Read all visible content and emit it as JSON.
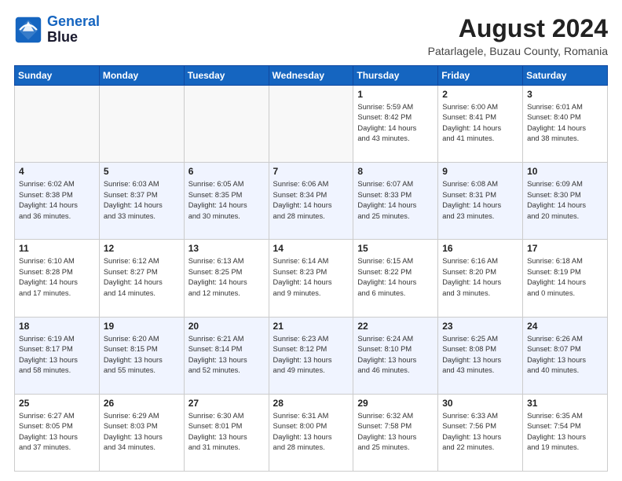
{
  "header": {
    "logo_line1": "General",
    "logo_line2": "Blue",
    "month_title": "August 2024",
    "location": "Patarlagele, Buzau County, Romania"
  },
  "days_of_week": [
    "Sunday",
    "Monday",
    "Tuesday",
    "Wednesday",
    "Thursday",
    "Friday",
    "Saturday"
  ],
  "weeks": [
    [
      {
        "day": "",
        "info": ""
      },
      {
        "day": "",
        "info": ""
      },
      {
        "day": "",
        "info": ""
      },
      {
        "day": "",
        "info": ""
      },
      {
        "day": "1",
        "info": "Sunrise: 5:59 AM\nSunset: 8:42 PM\nDaylight: 14 hours\nand 43 minutes."
      },
      {
        "day": "2",
        "info": "Sunrise: 6:00 AM\nSunset: 8:41 PM\nDaylight: 14 hours\nand 41 minutes."
      },
      {
        "day": "3",
        "info": "Sunrise: 6:01 AM\nSunset: 8:40 PM\nDaylight: 14 hours\nand 38 minutes."
      }
    ],
    [
      {
        "day": "4",
        "info": "Sunrise: 6:02 AM\nSunset: 8:38 PM\nDaylight: 14 hours\nand 36 minutes."
      },
      {
        "day": "5",
        "info": "Sunrise: 6:03 AM\nSunset: 8:37 PM\nDaylight: 14 hours\nand 33 minutes."
      },
      {
        "day": "6",
        "info": "Sunrise: 6:05 AM\nSunset: 8:35 PM\nDaylight: 14 hours\nand 30 minutes."
      },
      {
        "day": "7",
        "info": "Sunrise: 6:06 AM\nSunset: 8:34 PM\nDaylight: 14 hours\nand 28 minutes."
      },
      {
        "day": "8",
        "info": "Sunrise: 6:07 AM\nSunset: 8:33 PM\nDaylight: 14 hours\nand 25 minutes."
      },
      {
        "day": "9",
        "info": "Sunrise: 6:08 AM\nSunset: 8:31 PM\nDaylight: 14 hours\nand 23 minutes."
      },
      {
        "day": "10",
        "info": "Sunrise: 6:09 AM\nSunset: 8:30 PM\nDaylight: 14 hours\nand 20 minutes."
      }
    ],
    [
      {
        "day": "11",
        "info": "Sunrise: 6:10 AM\nSunset: 8:28 PM\nDaylight: 14 hours\nand 17 minutes."
      },
      {
        "day": "12",
        "info": "Sunrise: 6:12 AM\nSunset: 8:27 PM\nDaylight: 14 hours\nand 14 minutes."
      },
      {
        "day": "13",
        "info": "Sunrise: 6:13 AM\nSunset: 8:25 PM\nDaylight: 14 hours\nand 12 minutes."
      },
      {
        "day": "14",
        "info": "Sunrise: 6:14 AM\nSunset: 8:23 PM\nDaylight: 14 hours\nand 9 minutes."
      },
      {
        "day": "15",
        "info": "Sunrise: 6:15 AM\nSunset: 8:22 PM\nDaylight: 14 hours\nand 6 minutes."
      },
      {
        "day": "16",
        "info": "Sunrise: 6:16 AM\nSunset: 8:20 PM\nDaylight: 14 hours\nand 3 minutes."
      },
      {
        "day": "17",
        "info": "Sunrise: 6:18 AM\nSunset: 8:19 PM\nDaylight: 14 hours\nand 0 minutes."
      }
    ],
    [
      {
        "day": "18",
        "info": "Sunrise: 6:19 AM\nSunset: 8:17 PM\nDaylight: 13 hours\nand 58 minutes."
      },
      {
        "day": "19",
        "info": "Sunrise: 6:20 AM\nSunset: 8:15 PM\nDaylight: 13 hours\nand 55 minutes."
      },
      {
        "day": "20",
        "info": "Sunrise: 6:21 AM\nSunset: 8:14 PM\nDaylight: 13 hours\nand 52 minutes."
      },
      {
        "day": "21",
        "info": "Sunrise: 6:23 AM\nSunset: 8:12 PM\nDaylight: 13 hours\nand 49 minutes."
      },
      {
        "day": "22",
        "info": "Sunrise: 6:24 AM\nSunset: 8:10 PM\nDaylight: 13 hours\nand 46 minutes."
      },
      {
        "day": "23",
        "info": "Sunrise: 6:25 AM\nSunset: 8:08 PM\nDaylight: 13 hours\nand 43 minutes."
      },
      {
        "day": "24",
        "info": "Sunrise: 6:26 AM\nSunset: 8:07 PM\nDaylight: 13 hours\nand 40 minutes."
      }
    ],
    [
      {
        "day": "25",
        "info": "Sunrise: 6:27 AM\nSunset: 8:05 PM\nDaylight: 13 hours\nand 37 minutes."
      },
      {
        "day": "26",
        "info": "Sunrise: 6:29 AM\nSunset: 8:03 PM\nDaylight: 13 hours\nand 34 minutes."
      },
      {
        "day": "27",
        "info": "Sunrise: 6:30 AM\nSunset: 8:01 PM\nDaylight: 13 hours\nand 31 minutes."
      },
      {
        "day": "28",
        "info": "Sunrise: 6:31 AM\nSunset: 8:00 PM\nDaylight: 13 hours\nand 28 minutes."
      },
      {
        "day": "29",
        "info": "Sunrise: 6:32 AM\nSunset: 7:58 PM\nDaylight: 13 hours\nand 25 minutes."
      },
      {
        "day": "30",
        "info": "Sunrise: 6:33 AM\nSunset: 7:56 PM\nDaylight: 13 hours\nand 22 minutes."
      },
      {
        "day": "31",
        "info": "Sunrise: 6:35 AM\nSunset: 7:54 PM\nDaylight: 13 hours\nand 19 minutes."
      }
    ]
  ]
}
